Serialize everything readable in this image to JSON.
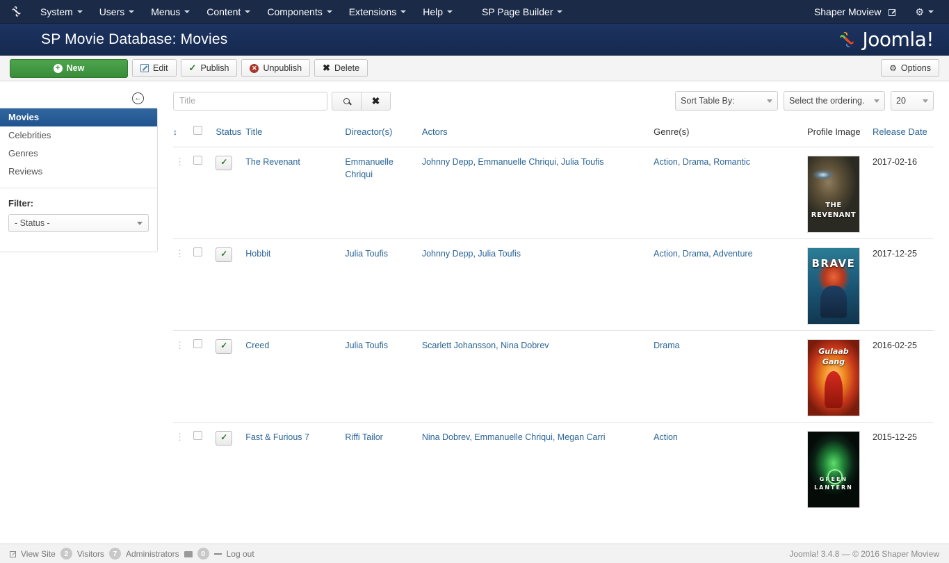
{
  "topbar": {
    "logo_icon": "joomla-icon",
    "menus": [
      {
        "label": "System"
      },
      {
        "label": "Users"
      },
      {
        "label": "Menus"
      },
      {
        "label": "Content"
      },
      {
        "label": "Components"
      },
      {
        "label": "Extensions"
      },
      {
        "label": "Help"
      },
      {
        "label": "SP Page Builder"
      }
    ],
    "site_name": "Shaper Moview",
    "external_icon": "external-link-icon",
    "gear_icon": "gear-icon"
  },
  "header": {
    "title": "SP Movie Database: Movies",
    "brand": "Joomla!",
    "brand_icon": "joomla-logo-icon"
  },
  "toolbar": {
    "new": "New",
    "edit": "Edit",
    "publish": "Publish",
    "unpublish": "Unpublish",
    "delete": "Delete",
    "options": "Options"
  },
  "sidebar": {
    "collapse_icon": "collapse-left-icon",
    "items": [
      {
        "label": "Movies",
        "active": true
      },
      {
        "label": "Celebrities",
        "active": false
      },
      {
        "label": "Genres",
        "active": false
      },
      {
        "label": "Reviews",
        "active": false
      }
    ],
    "filter_title": "Filter:",
    "status_filter": "- Status -"
  },
  "search": {
    "placeholder": "Title",
    "value": "",
    "search_icon": "search-icon",
    "clear_icon": "clear-x-icon"
  },
  "controls": {
    "sort_table_by": "Sort Table By:",
    "select_ordering": "Select the ordering.",
    "limit": "20"
  },
  "table": {
    "headers": {
      "ordering": "↕",
      "check_all": "",
      "status": "Status",
      "title": "Title",
      "director": "Direactor(s)",
      "actors": "Actors",
      "genres": "Genre(s)",
      "profile_image": "Profile Image",
      "release_date": "Release Date"
    },
    "rows": [
      {
        "title": "The Revenant",
        "director": "Emmanuelle Chriqui",
        "actors": "Johnny Depp, Emmanuelle Chriqui, Julia Toufis",
        "genres": "Action, Drama, Romantic",
        "release_date": "2017-02-16",
        "poster_label": "THE REVENANT",
        "poster_class": "p-revenant",
        "published": true
      },
      {
        "title": "Hobbit",
        "director": "Julia Toufis",
        "actors": "Johnny Depp, Julia Toufis",
        "genres": "Action, Drama, Adventure",
        "release_date": "2017-12-25",
        "poster_label": "BRAVE",
        "poster_class": "p-brave",
        "published": true
      },
      {
        "title": "Creed",
        "director": "Julia Toufis",
        "actors": "Scarlett Johansson, Nina Dobrev",
        "genres": "Drama",
        "release_date": "2016-02-25",
        "poster_label": "Gulaab Gang",
        "poster_class": "p-gulaab",
        "published": true
      },
      {
        "title": "Fast & Furious 7",
        "director": "Riffi Tailor",
        "actors": "Nina Dobrev, Emmanuelle Chriqui, Megan Carri",
        "genres": "Action",
        "release_date": "2015-12-25",
        "poster_label": "GREEN LANTERN",
        "poster_class": "p-lantern",
        "published": true
      }
    ]
  },
  "footer": {
    "view_site": "View Site",
    "visitors_count": "2",
    "visitors_label": "Visitors",
    "administrators_count": "7",
    "administrators_label": "Administrators",
    "messages_count": "0",
    "log_out": "Log out",
    "copyright": "Joomla! 3.4.8 — © 2016 Shaper Moview"
  },
  "colors": {
    "topbar": "#1a2a47",
    "header": "#1c3462",
    "active_nav": "#2a5f9e",
    "link": "#2a6496",
    "new_button": "#3a8c3a"
  }
}
